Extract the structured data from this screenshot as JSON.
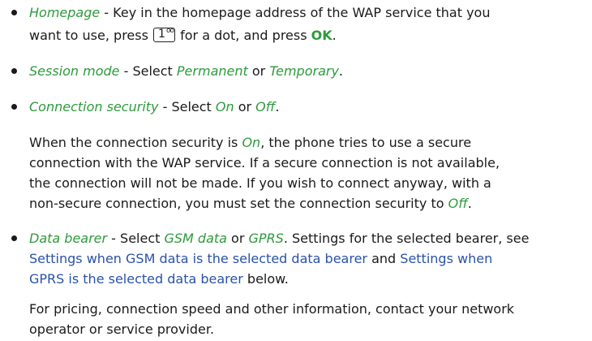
{
  "items": [
    {
      "term": "Homepage",
      "text1": " - Key in the homepage address of the WAP service that you",
      "text2a": "want to use, press ",
      "key_num": "1",
      "key_sym": "oo",
      "text2b": " for a dot, and press ",
      "ok_label": "OK",
      "text2c": "."
    },
    {
      "term": "Session mode",
      "text1": " - Select ",
      "opt1": "Permanent",
      "or": " or ",
      "opt2": "Temporary",
      "end": "."
    },
    {
      "term": "Connection security",
      "text1": " - Select ",
      "opt1": "On",
      "or": " or ",
      "opt2": "Off",
      "end": "."
    },
    {
      "term": "Data bearer",
      "text1": " - Select ",
      "opt1": "GSM data",
      "or": " or ",
      "opt2": "GPRS",
      "text2": ". Settings for the selected bearer, see",
      "link1": "Settings when GSM data is the selected data bearer",
      "and": " and ",
      "link2a": "Settings when",
      "link2b": "GPRS is the selected data bearer",
      "below": " below."
    }
  ],
  "security_para": {
    "l1a": "When the connection security is ",
    "l1_on": "On",
    "l1b": ", the phone tries to use a secure",
    "l2": "connection with the WAP service. If a secure connection is not available,",
    "l3": "the connection will not be made. If you wish to connect anyway, with a",
    "l4a": "non-secure connection, you must set the connection security to ",
    "l4_off": "Off",
    "l4b": "."
  },
  "pricing_para": {
    "l1": "For pricing, connection speed and other information, contact your network",
    "l2": "operator or service provider."
  }
}
